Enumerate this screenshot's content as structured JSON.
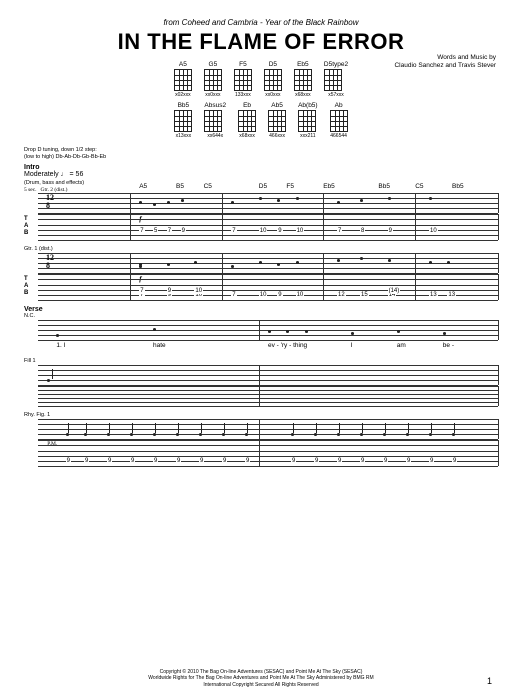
{
  "source": {
    "prefix": "from Coheed and Cambria - ",
    "album": "Year of the Black Rainbow"
  },
  "title": "IN THE FLAME OF ERROR",
  "credits": {
    "line1": "Words and Music by",
    "line2": "Claudio Sanchez and Travis Stever"
  },
  "chordRow1": [
    {
      "name": "A5",
      "sub": "x02xxx"
    },
    {
      "name": "G5",
      "sub": "xx0xxx"
    },
    {
      "name": "F5",
      "sub": "133xxx"
    },
    {
      "name": "D5",
      "sub": "xx0xxx"
    },
    {
      "name": "Eb5",
      "sub": "x68xxx"
    },
    {
      "name": "D5type2",
      "sub": "x57xxx"
    }
  ],
  "chordRow2": [
    {
      "name": "Bb5",
      "sub": "x13xxx"
    },
    {
      "name": "Absus2",
      "sub": "xx644x"
    },
    {
      "name": "Eb",
      "sub": "x68xxx"
    },
    {
      "name": "Ab5",
      "sub": "466xxx"
    },
    {
      "name": "Ab(b5)",
      "sub": "xxx211"
    },
    {
      "name": "Ab",
      "sub": "466544"
    }
  ],
  "tuning": {
    "l1": "Drop D tuning, down 1/2 step:",
    "l2": "(low to high) Db-Ab-Db-Gb-Bb-Eb"
  },
  "intro": {
    "label": "Intro",
    "tempo": "Moderately ♩ = 56"
  },
  "gtr2": {
    "label": "Gtr. 2 (dist.)",
    "instr": "(Drum, bass and effects)",
    "bars": "5 sec."
  },
  "gtr1": {
    "label": "Gtr. 1 (dist.)"
  },
  "sys1_chords": [
    "A5",
    "B5",
    "C5",
    "D5",
    "F5",
    "Eb5",
    "Bb5",
    "C5",
    "Bb5"
  ],
  "sys1_tab_gtr2": [
    {
      "p": 22,
      "t": 14,
      "v": "7"
    },
    {
      "p": 25,
      "t": 14,
      "v": "5"
    },
    {
      "p": 28,
      "t": 14,
      "v": "7"
    },
    {
      "p": 31,
      "t": 14,
      "v": "9"
    },
    {
      "p": 42,
      "t": 14,
      "v": "7"
    },
    {
      "p": 48,
      "t": 14,
      "v": "10"
    },
    {
      "p": 52,
      "t": 14,
      "v": "9"
    },
    {
      "p": 56,
      "t": 14,
      "v": "10"
    },
    {
      "p": 65,
      "t": 14,
      "v": "7"
    },
    {
      "p": 70,
      "t": 14,
      "v": "8"
    },
    {
      "p": 76,
      "t": 14,
      "v": "9"
    },
    {
      "p": 85,
      "t": 14,
      "v": "10"
    }
  ],
  "sys1_tab_gtr1": [
    {
      "p": 22,
      "t": 18,
      "v": "7"
    },
    {
      "p": 22,
      "t": 14,
      "v": "7"
    },
    {
      "p": 28,
      "t": 18,
      "v": "9"
    },
    {
      "p": 28,
      "t": 14,
      "v": "9"
    },
    {
      "p": 34,
      "t": 18,
      "v": "10"
    },
    {
      "p": 34,
      "t": 14,
      "v": "10"
    },
    {
      "p": 42,
      "t": 18,
      "v": "7"
    },
    {
      "p": 48,
      "t": 18,
      "v": "10"
    },
    {
      "p": 52,
      "t": 18,
      "v": "9"
    },
    {
      "p": 56,
      "t": 18,
      "v": "10"
    },
    {
      "p": 65,
      "t": 18,
      "v": "12"
    },
    {
      "p": 70,
      "t": 18,
      "v": "15"
    },
    {
      "p": 76,
      "t": 18,
      "v": "14"
    },
    {
      "p": 76,
      "t": 14,
      "v": "(14)"
    },
    {
      "p": 85,
      "t": 18,
      "v": "13"
    },
    {
      "p": 89,
      "t": 18,
      "v": "13"
    }
  ],
  "verse": {
    "label": "Verse",
    "nc": "N.C."
  },
  "lyrics": [
    {
      "p": 4,
      "t": "1. I"
    },
    {
      "p": 25,
      "t": "hate"
    },
    {
      "p": 50,
      "t": "ev - 'ry - thing"
    },
    {
      "p": 68,
      "t": "I"
    },
    {
      "p": 78,
      "t": "am"
    },
    {
      "p": 88,
      "t": "be -"
    }
  ],
  "fill1": "Fill 1",
  "rhyfig": {
    "label": "Rhy. Fig. 1",
    "pm": "P.M."
  },
  "rhy_tab": [
    {
      "p": 6,
      "v": "9"
    },
    {
      "p": 10,
      "v": "9"
    },
    {
      "p": 15,
      "v": "9"
    },
    {
      "p": 20,
      "v": "9"
    },
    {
      "p": 25,
      "v": "9"
    },
    {
      "p": 30,
      "v": "9"
    },
    {
      "p": 35,
      "v": "9"
    },
    {
      "p": 40,
      "v": "9"
    },
    {
      "p": 45,
      "v": "9"
    },
    {
      "p": 55,
      "v": "9"
    },
    {
      "p": 60,
      "v": "9"
    },
    {
      "p": 65,
      "v": "9"
    },
    {
      "p": 70,
      "v": "9"
    },
    {
      "p": 75,
      "v": "9"
    },
    {
      "p": 80,
      "v": "9"
    },
    {
      "p": 85,
      "v": "9"
    },
    {
      "p": 90,
      "v": "9"
    }
  ],
  "copyright": {
    "l1": "Copyright © 2010 The Bag On-line Adventures (SESAC) and Point Me At The Sky (SESAC)",
    "l2": "Worldwide Rights for The Bag On-line Adventures and Point Me At The Sky Administered by BMG RM",
    "l3": "International Copyright Secured   All Rights Reserved"
  },
  "pageNum": "1",
  "dyn_f": "f"
}
